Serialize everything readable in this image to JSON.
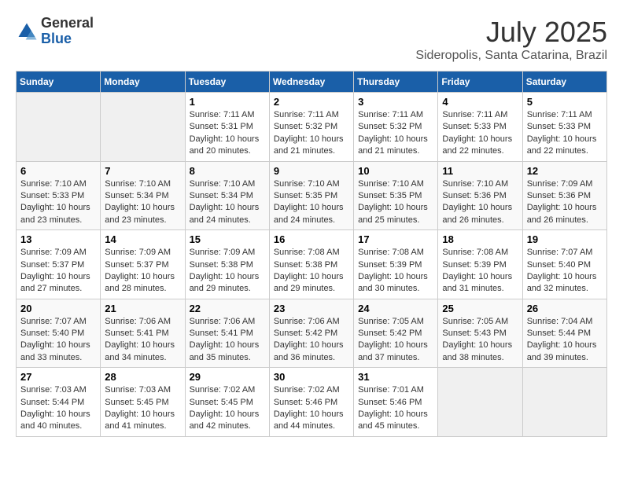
{
  "logo": {
    "general": "General",
    "blue": "Blue"
  },
  "title": "July 2025",
  "location": "Sideropolis, Santa Catarina, Brazil",
  "days_of_week": [
    "Sunday",
    "Monday",
    "Tuesday",
    "Wednesday",
    "Thursday",
    "Friday",
    "Saturday"
  ],
  "weeks": [
    [
      {
        "day": "",
        "sunrise": "",
        "sunset": "",
        "daylight": ""
      },
      {
        "day": "",
        "sunrise": "",
        "sunset": "",
        "daylight": ""
      },
      {
        "day": "1",
        "sunrise": "Sunrise: 7:11 AM",
        "sunset": "Sunset: 5:31 PM",
        "daylight": "Daylight: 10 hours and 20 minutes."
      },
      {
        "day": "2",
        "sunrise": "Sunrise: 7:11 AM",
        "sunset": "Sunset: 5:32 PM",
        "daylight": "Daylight: 10 hours and 21 minutes."
      },
      {
        "day": "3",
        "sunrise": "Sunrise: 7:11 AM",
        "sunset": "Sunset: 5:32 PM",
        "daylight": "Daylight: 10 hours and 21 minutes."
      },
      {
        "day": "4",
        "sunrise": "Sunrise: 7:11 AM",
        "sunset": "Sunset: 5:33 PM",
        "daylight": "Daylight: 10 hours and 22 minutes."
      },
      {
        "day": "5",
        "sunrise": "Sunrise: 7:11 AM",
        "sunset": "Sunset: 5:33 PM",
        "daylight": "Daylight: 10 hours and 22 minutes."
      }
    ],
    [
      {
        "day": "6",
        "sunrise": "Sunrise: 7:10 AM",
        "sunset": "Sunset: 5:33 PM",
        "daylight": "Daylight: 10 hours and 23 minutes."
      },
      {
        "day": "7",
        "sunrise": "Sunrise: 7:10 AM",
        "sunset": "Sunset: 5:34 PM",
        "daylight": "Daylight: 10 hours and 23 minutes."
      },
      {
        "day": "8",
        "sunrise": "Sunrise: 7:10 AM",
        "sunset": "Sunset: 5:34 PM",
        "daylight": "Daylight: 10 hours and 24 minutes."
      },
      {
        "day": "9",
        "sunrise": "Sunrise: 7:10 AM",
        "sunset": "Sunset: 5:35 PM",
        "daylight": "Daylight: 10 hours and 24 minutes."
      },
      {
        "day": "10",
        "sunrise": "Sunrise: 7:10 AM",
        "sunset": "Sunset: 5:35 PM",
        "daylight": "Daylight: 10 hours and 25 minutes."
      },
      {
        "day": "11",
        "sunrise": "Sunrise: 7:10 AM",
        "sunset": "Sunset: 5:36 PM",
        "daylight": "Daylight: 10 hours and 26 minutes."
      },
      {
        "day": "12",
        "sunrise": "Sunrise: 7:09 AM",
        "sunset": "Sunset: 5:36 PM",
        "daylight": "Daylight: 10 hours and 26 minutes."
      }
    ],
    [
      {
        "day": "13",
        "sunrise": "Sunrise: 7:09 AM",
        "sunset": "Sunset: 5:37 PM",
        "daylight": "Daylight: 10 hours and 27 minutes."
      },
      {
        "day": "14",
        "sunrise": "Sunrise: 7:09 AM",
        "sunset": "Sunset: 5:37 PM",
        "daylight": "Daylight: 10 hours and 28 minutes."
      },
      {
        "day": "15",
        "sunrise": "Sunrise: 7:09 AM",
        "sunset": "Sunset: 5:38 PM",
        "daylight": "Daylight: 10 hours and 29 minutes."
      },
      {
        "day": "16",
        "sunrise": "Sunrise: 7:08 AM",
        "sunset": "Sunset: 5:38 PM",
        "daylight": "Daylight: 10 hours and 29 minutes."
      },
      {
        "day": "17",
        "sunrise": "Sunrise: 7:08 AM",
        "sunset": "Sunset: 5:39 PM",
        "daylight": "Daylight: 10 hours and 30 minutes."
      },
      {
        "day": "18",
        "sunrise": "Sunrise: 7:08 AM",
        "sunset": "Sunset: 5:39 PM",
        "daylight": "Daylight: 10 hours and 31 minutes."
      },
      {
        "day": "19",
        "sunrise": "Sunrise: 7:07 AM",
        "sunset": "Sunset: 5:40 PM",
        "daylight": "Daylight: 10 hours and 32 minutes."
      }
    ],
    [
      {
        "day": "20",
        "sunrise": "Sunrise: 7:07 AM",
        "sunset": "Sunset: 5:40 PM",
        "daylight": "Daylight: 10 hours and 33 minutes."
      },
      {
        "day": "21",
        "sunrise": "Sunrise: 7:06 AM",
        "sunset": "Sunset: 5:41 PM",
        "daylight": "Daylight: 10 hours and 34 minutes."
      },
      {
        "day": "22",
        "sunrise": "Sunrise: 7:06 AM",
        "sunset": "Sunset: 5:41 PM",
        "daylight": "Daylight: 10 hours and 35 minutes."
      },
      {
        "day": "23",
        "sunrise": "Sunrise: 7:06 AM",
        "sunset": "Sunset: 5:42 PM",
        "daylight": "Daylight: 10 hours and 36 minutes."
      },
      {
        "day": "24",
        "sunrise": "Sunrise: 7:05 AM",
        "sunset": "Sunset: 5:42 PM",
        "daylight": "Daylight: 10 hours and 37 minutes."
      },
      {
        "day": "25",
        "sunrise": "Sunrise: 7:05 AM",
        "sunset": "Sunset: 5:43 PM",
        "daylight": "Daylight: 10 hours and 38 minutes."
      },
      {
        "day": "26",
        "sunrise": "Sunrise: 7:04 AM",
        "sunset": "Sunset: 5:44 PM",
        "daylight": "Daylight: 10 hours and 39 minutes."
      }
    ],
    [
      {
        "day": "27",
        "sunrise": "Sunrise: 7:03 AM",
        "sunset": "Sunset: 5:44 PM",
        "daylight": "Daylight: 10 hours and 40 minutes."
      },
      {
        "day": "28",
        "sunrise": "Sunrise: 7:03 AM",
        "sunset": "Sunset: 5:45 PM",
        "daylight": "Daylight: 10 hours and 41 minutes."
      },
      {
        "day": "29",
        "sunrise": "Sunrise: 7:02 AM",
        "sunset": "Sunset: 5:45 PM",
        "daylight": "Daylight: 10 hours and 42 minutes."
      },
      {
        "day": "30",
        "sunrise": "Sunrise: 7:02 AM",
        "sunset": "Sunset: 5:46 PM",
        "daylight": "Daylight: 10 hours and 44 minutes."
      },
      {
        "day": "31",
        "sunrise": "Sunrise: 7:01 AM",
        "sunset": "Sunset: 5:46 PM",
        "daylight": "Daylight: 10 hours and 45 minutes."
      },
      {
        "day": "",
        "sunrise": "",
        "sunset": "",
        "daylight": ""
      },
      {
        "day": "",
        "sunrise": "",
        "sunset": "",
        "daylight": ""
      }
    ]
  ]
}
